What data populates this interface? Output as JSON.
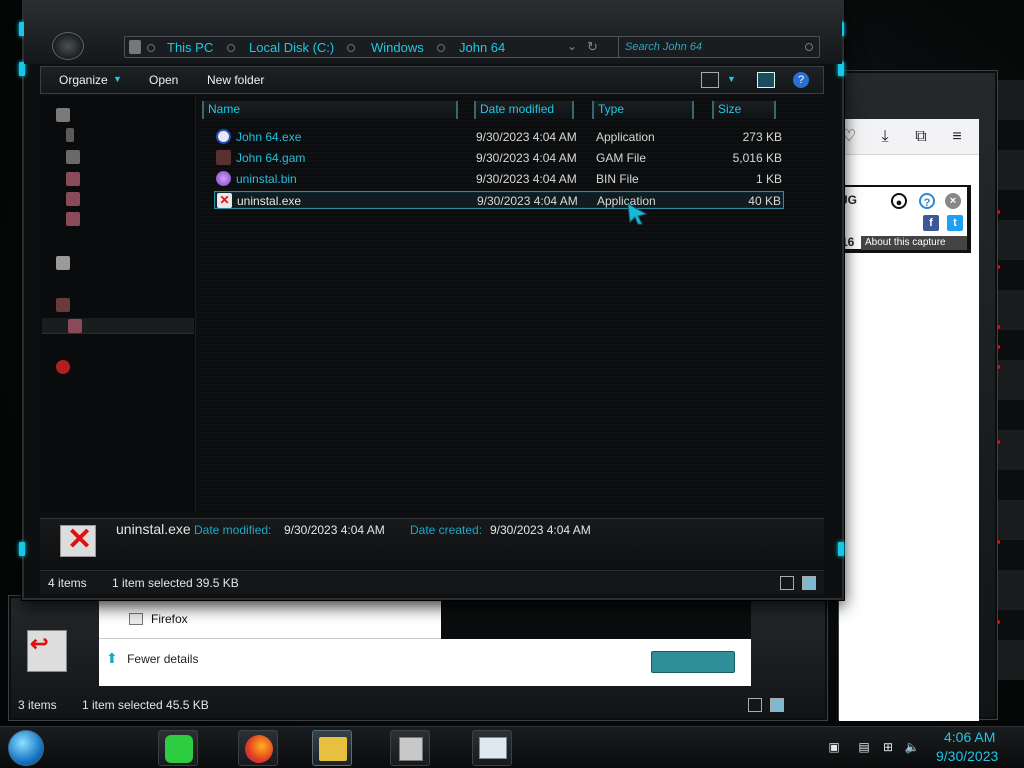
{
  "explorer": {
    "breadcrumb": [
      "This PC",
      "Local Disk (C:)",
      "Windows",
      "John 64"
    ],
    "search_placeholder": "Search John 64",
    "commands": {
      "organize": "Organize",
      "open": "Open",
      "new_folder": "New folder"
    },
    "columns": {
      "name": "Name",
      "date": "Date modified",
      "type": "Type",
      "size": "Size"
    },
    "files": [
      {
        "name": "John 64.exe",
        "date": "9/30/2023 4:04 AM",
        "type": "Application",
        "size": "273 KB",
        "icon": "blue-app-icon"
      },
      {
        "name": "John 64.gam",
        "date": "9/30/2023 4:04 AM",
        "type": "GAM File",
        "size": "5,016 KB",
        "icon": "gam-file-icon"
      },
      {
        "name": "uninstal.bin",
        "date": "9/30/2023 4:04 AM",
        "type": "BIN File",
        "size": "1 KB",
        "icon": "bin-file-icon"
      },
      {
        "name": "uninstal.exe",
        "date": "9/30/2023 4:04 AM",
        "type": "Application",
        "size": "40 KB",
        "icon": "uninstall-app-icon",
        "selected": true
      }
    ],
    "details": {
      "filename": "uninstal.exe",
      "modified_label": "Date modified:",
      "modified_value": "9/30/2023 4:04 AM",
      "created_label": "Date created:",
      "created_value": "9/30/2023 4:04 AM"
    },
    "status": {
      "items": "4 items",
      "selected": "1 item selected  39.5 KB"
    }
  },
  "back_explorer": {
    "firefox_label": "Firefox",
    "fewer_details": "Fewer details",
    "status_items": "3 items",
    "status_selected": "1 item selected  45.5 KB"
  },
  "browser": {
    "fragment_text": "JG",
    "number_text": "16",
    "about_capture": "About this capture"
  },
  "taskbar": {
    "time": "4:06 AM",
    "date": "9/30/2023"
  },
  "colors": {
    "accent": "#1fc7e6",
    "selection_border": "#2f8ba0",
    "window_bg": "#0d0f10"
  }
}
